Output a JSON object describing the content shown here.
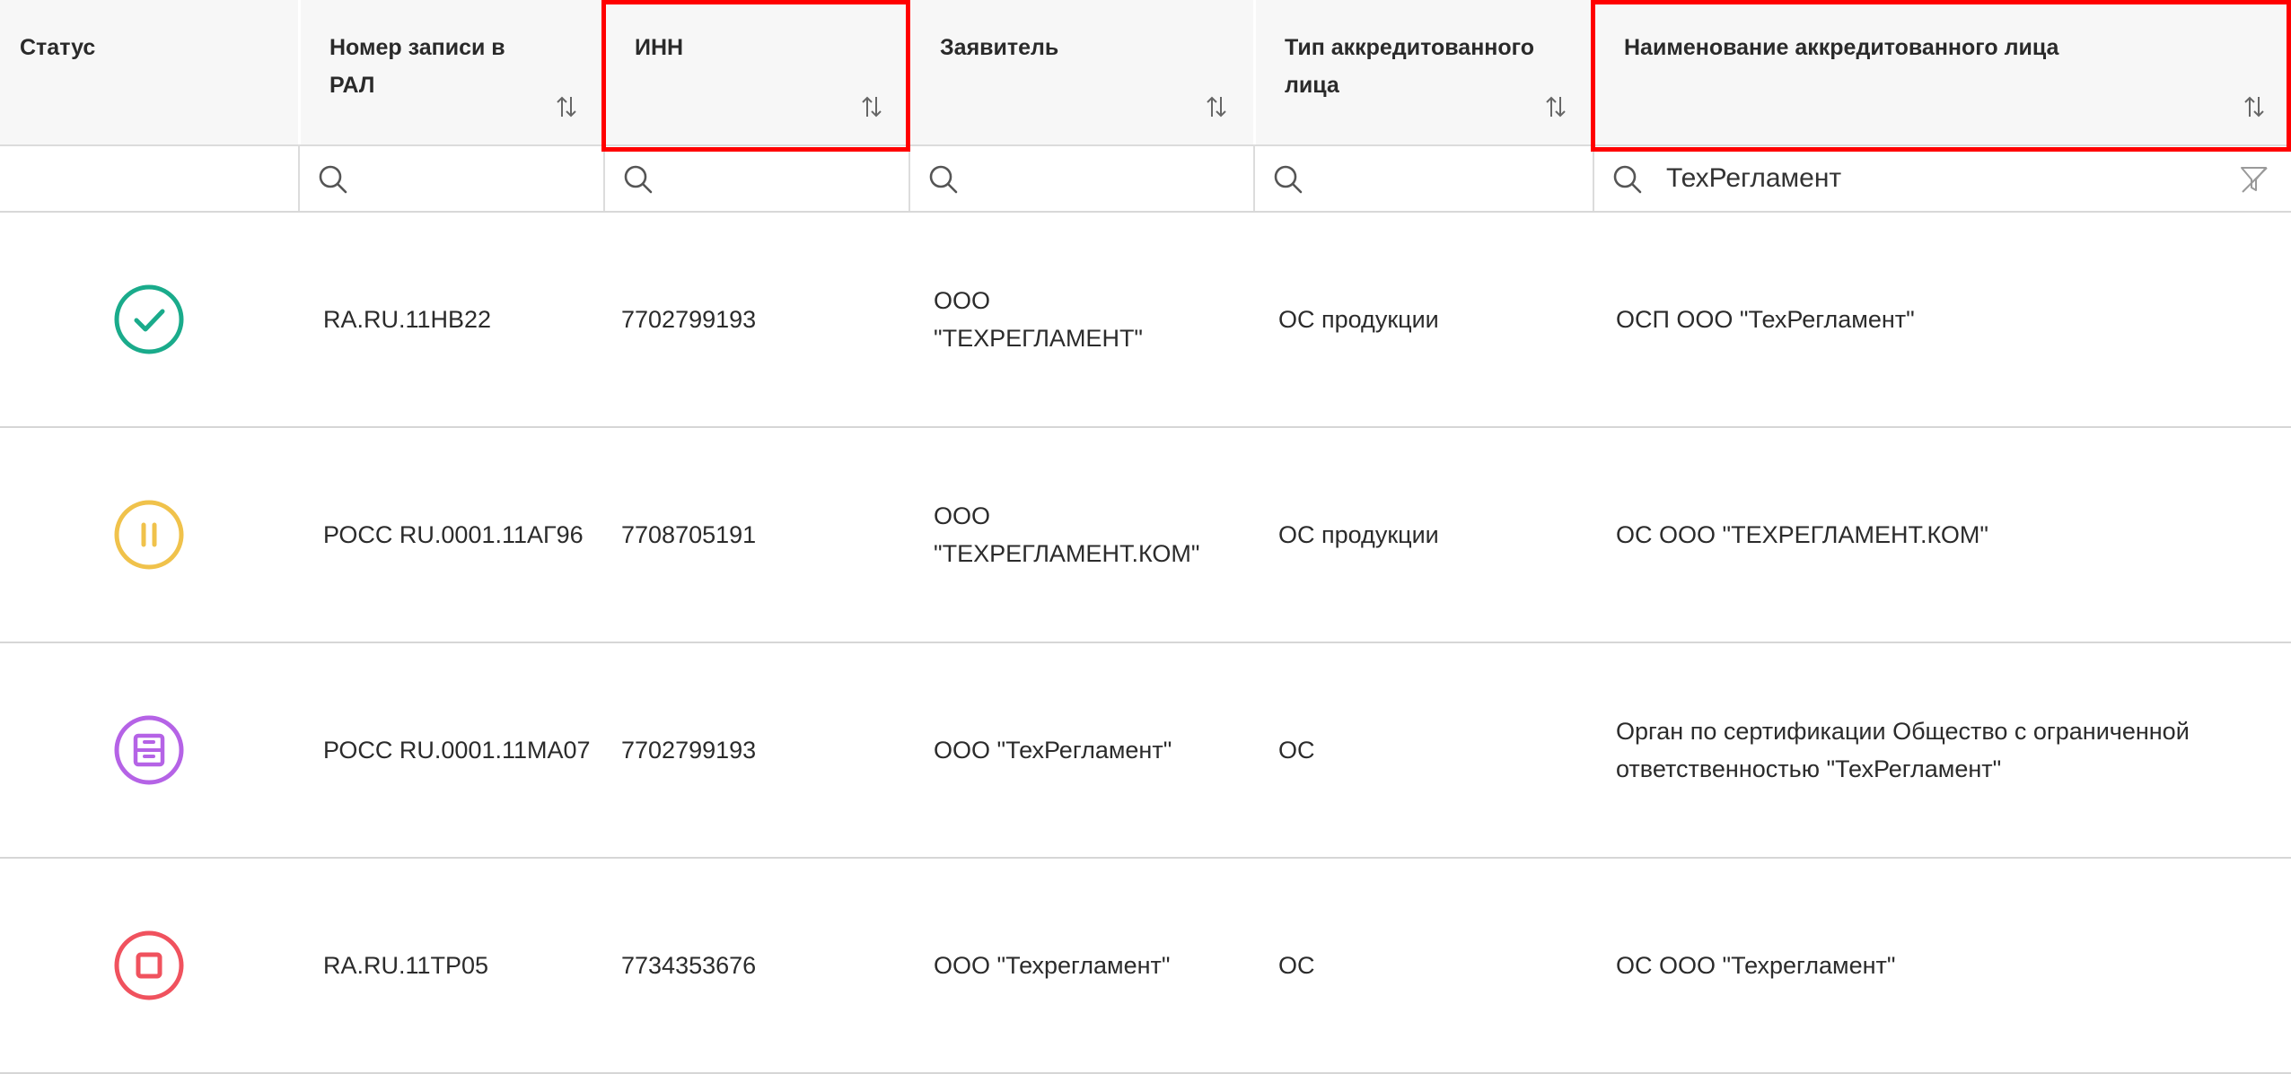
{
  "columns": [
    {
      "id": "status",
      "label": "Статус"
    },
    {
      "id": "reg_number",
      "label": "Номер записи в РАЛ"
    },
    {
      "id": "inn",
      "label": "ИНН"
    },
    {
      "id": "applicant",
      "label": "Заявитель"
    },
    {
      "id": "entity_type",
      "label": "Тип аккредитованного лица"
    },
    {
      "id": "entity_name",
      "label": "Наименование аккредитованного лица"
    }
  ],
  "filters": {
    "reg_number": "",
    "inn": "",
    "applicant": "",
    "entity_type": "",
    "entity_name": "ТехРегламент"
  },
  "rows": [
    {
      "status_icon": "check-circle-icon",
      "status_color": "#1aab8b",
      "reg_number": "RA.RU.11НВ22",
      "inn": "7702799193",
      "applicant": "ООО \"ТЕХРЕГЛАМЕНТ\"",
      "entity_type": "ОС продукции",
      "entity_name": "ОСП ООО \"ТехРегламент\""
    },
    {
      "status_icon": "pause-circle-icon",
      "status_color": "#f0c24b",
      "reg_number": "РОСС RU.0001.11АГ96",
      "inn": "7708705191",
      "applicant": "ООО \"ТЕХРЕГЛАМЕНТ.КОМ\"",
      "entity_type": "ОС продукции",
      "entity_name": "ОС ООО \"ТЕХРЕГЛАМЕНТ.КОМ\""
    },
    {
      "status_icon": "archive-circle-icon",
      "status_color": "#b563e6",
      "reg_number": "РОСС RU.0001.11МА07",
      "inn": "7702799193",
      "applicant": "ООО \"ТехРегламент\"",
      "entity_type": "ОС",
      "entity_name": "Орган по сертификации Общество с ограниченной ответственностью \"ТехРегламент\""
    },
    {
      "status_icon": "stop-circle-icon",
      "status_color": "#f0525e",
      "reg_number": "RA.RU.11ТР05",
      "inn": "7734353676",
      "applicant": "ООО \"Техрегламент\"",
      "entity_type": "ОС",
      "entity_name": "ОС ООО \"Техрегламент\""
    }
  ],
  "colors": {
    "header_bg": "#f7f7f7",
    "highlight": "#ff0000",
    "border": "#d6d6d6",
    "icon_gray": "#555555"
  }
}
